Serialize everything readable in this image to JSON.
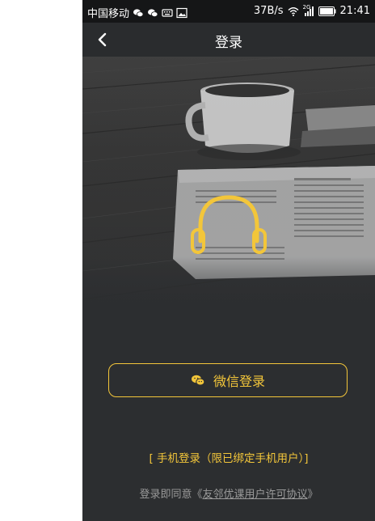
{
  "status_bar": {
    "carrier": "中国移动",
    "speed": "37B/s",
    "network": "2G",
    "time": "21:41"
  },
  "nav": {
    "title": "登录"
  },
  "hero": {
    "icon": "headphones-icon"
  },
  "login": {
    "wechat_label": "微信登录",
    "phone_label": "[ 手机登录（限已绑定手机用户）]"
  },
  "agreement": {
    "prefix": "登录即同意《",
    "link": "友邻优课用户许可协议",
    "suffix": "》"
  },
  "colors": {
    "accent": "#f3c63a",
    "background": "#2c2e30",
    "status_bar": "#151617"
  }
}
